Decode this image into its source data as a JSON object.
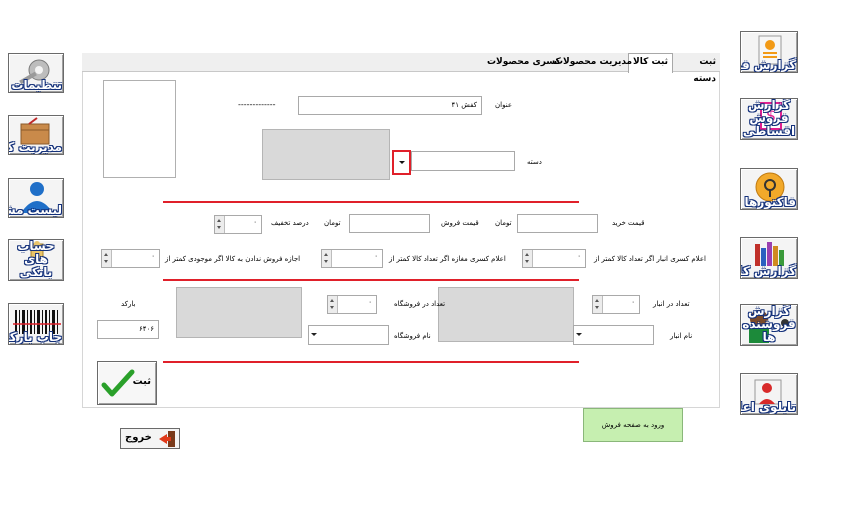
{
  "right_nav": [
    {
      "label": "گزارش فروش",
      "icon": "sales-report-icon"
    },
    {
      "label": "گزارش فروش اقساطی",
      "icon": "installment-report-icon"
    },
    {
      "label": "فاکتورها",
      "icon": "invoices-icon"
    },
    {
      "label": "گزارش کالاها",
      "icon": "goods-report-icon"
    },
    {
      "label": "گزارش فروشنده ها",
      "icon": "sellers-report-icon"
    },
    {
      "label": "تابلوی اعلانات",
      "icon": "notice-board-icon"
    }
  ],
  "left_nav": [
    {
      "label": "تنظیمات",
      "icon": "settings-icon"
    },
    {
      "label": "مدیریت کالا",
      "icon": "goods-management-icon"
    },
    {
      "label": "لیست مشتریان",
      "icon": "customers-icon"
    },
    {
      "label": "حساب های بانکی",
      "icon": "bank-accounts-icon"
    },
    {
      "label": "چاپ بارکد",
      "icon": "barcode-print-icon"
    }
  ],
  "tabs": [
    {
      "label": "ثبت دسته",
      "active": false
    },
    {
      "label": "ثبت کالا",
      "active": true
    },
    {
      "label": "مدیریت محصولات",
      "active": false
    },
    {
      "label": "کسری محصولات",
      "active": false
    }
  ],
  "form": {
    "title_label": "عنوان",
    "title_value": "کفش ۴۱",
    "dashes": "-------------",
    "category_label": "دسته",
    "category_value": "",
    "buy_price_label": "قیمت خرید",
    "buy_price_value": "",
    "currency1": "تومان",
    "sell_price_label": "قیمت فروش",
    "sell_price_value": "",
    "currency2": "تومان",
    "discount_label": "درصد تخفیف",
    "discount_value": "۰",
    "warehouse_low_label": "اعلام کسری انبار اگر تعداد کالا کمتر از",
    "warehouse_low_value": "۰",
    "store_low_label": "اعلام کسری مغازه اگر تعداد کالا کمتر از",
    "store_low_value": "۰",
    "no_sell_label": "اجازه فروش ندادن به کالا اگر موجودی کمتر از",
    "no_sell_value": "۰",
    "warehouse_qty_label": "تعداد در انبار",
    "warehouse_qty_value": "۰",
    "store_qty_label": "تعداد در فروشگاه",
    "store_qty_value": "۰",
    "warehouse_name_label": "نام انبار",
    "warehouse_name_value": "",
    "store_name_label": "نام فروشگاه",
    "store_name_value": "",
    "barcode_label": "بارکد",
    "barcode_value": "۶۴۰۶",
    "submit_label": "ثبت"
  },
  "sales_page_button": "ورود به صفحه فروش",
  "exit_button": "خروج",
  "colors": {
    "accent_red": "#e0202a",
    "sales_btn_bg": "#c6efb0",
    "check_green": "#2aa02a"
  }
}
